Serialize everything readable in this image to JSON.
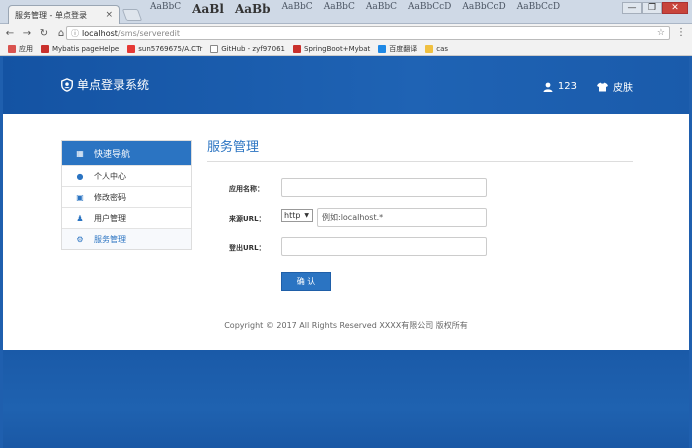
{
  "browser": {
    "tab_title": "服务管理 - 单点登录",
    "tab_close": "×",
    "ribbon": [
      "AaBbC",
      "AaBl",
      "AaBb",
      "AaBbC",
      "AaBbC",
      "AaBbC",
      "AaBbCcD",
      "AaBbCcD",
      "AaBbCcD",
      "AaBbCcD"
    ],
    "window_controls": {
      "minimize": "—",
      "restore": "❐",
      "close": "✕"
    },
    "url_host": "localhost",
    "url_path": "/sms/serveredit",
    "bookmarks": [
      {
        "label": "应用",
        "color": "#d9534f"
      },
      {
        "label": "Mybatis pageHelpe",
        "color": "#c9302c"
      },
      {
        "label": "sun5769675/A.CTr",
        "color": "#e53935"
      },
      {
        "label": "GitHub - zyf97061",
        "color": "#888888"
      },
      {
        "label": "SpringBoot+Mybat",
        "color": "#c9302c"
      },
      {
        "label": "百度翻译",
        "color": "#1e88e5"
      },
      {
        "label": "cas",
        "color": "#f0c040"
      }
    ]
  },
  "header": {
    "brand": "单点登录系统",
    "user": "123",
    "skin": "皮肤"
  },
  "sidebar": {
    "items": [
      {
        "label": "快速导航",
        "icon": "grid-icon"
      },
      {
        "label": "个人中心",
        "icon": "user-icon"
      },
      {
        "label": "修改密码",
        "icon": "lock-icon"
      },
      {
        "label": "用户管理",
        "icon": "users-icon"
      },
      {
        "label": "服务管理",
        "icon": "gear-icon"
      }
    ]
  },
  "main": {
    "title": "服务管理",
    "form": {
      "app_name_label": "应用名称：",
      "app_name_value": "",
      "source_url_label": "来源URL：",
      "protocol": "http",
      "source_url_placeholder": "例如:localhost.*",
      "logout_url_label": "登出URL：",
      "logout_url_value": "",
      "submit_label": "确 认"
    },
    "footer": "Copyright © 2017 All Rights Reserved XXXX有限公司 版权所有"
  }
}
